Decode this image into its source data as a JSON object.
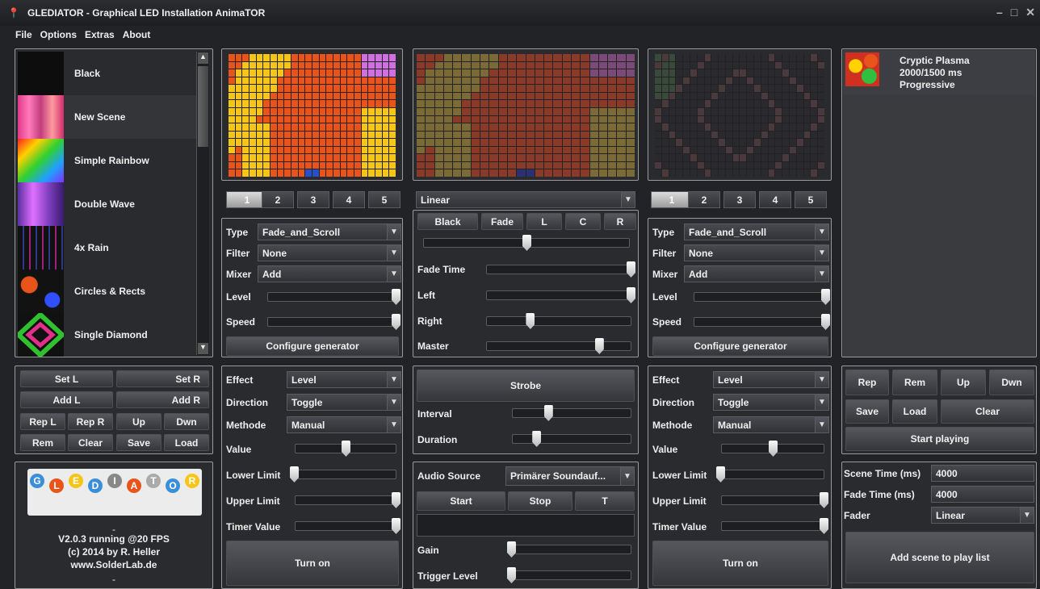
{
  "window": {
    "title": "GLEDIATOR - Graphical LED Installation AnimaTOR",
    "min": "–",
    "max": "□",
    "close": "✕"
  },
  "menu": [
    "File",
    "Options",
    "Extras",
    "About"
  ],
  "scenes": [
    {
      "name": "Black"
    },
    {
      "name": "New Scene"
    },
    {
      "name": "Simple Rainbow"
    },
    {
      "name": "Double Wave"
    },
    {
      "name": "4x Rain"
    },
    {
      "name": "Circles & Rects"
    },
    {
      "name": "Single Diamond"
    }
  ],
  "scene_buttons": [
    "Set L",
    "Set R",
    "Add L",
    "Add R",
    "Rep L",
    "Rep R",
    "Up",
    "Dwn",
    "Rem",
    "Clear",
    "Save",
    "Load"
  ],
  "about": {
    "logo_letters": [
      "G",
      "L",
      "E",
      "D",
      "I",
      "A",
      "T",
      "O",
      "R"
    ],
    "dash1": "-",
    "version": "V2.0.3 running @20 FPS",
    "copyright": "(c) 2014 by R. Heller",
    "url": "www.SolderLab.de",
    "dash2": "-"
  },
  "left_gen": {
    "tabs": [
      "1",
      "2",
      "3",
      "4",
      "5"
    ],
    "type_label": "Type",
    "type_value": "Fade_and_Scroll",
    "filter_label": "Filter",
    "filter_value": "None",
    "mixer_label": "Mixer",
    "mixer_value": "Add",
    "level_label": "Level",
    "level_pct": 100,
    "speed_label": "Speed",
    "speed_pct": 100,
    "configure": "Configure generator",
    "effect_label": "Effect",
    "effect_value": "Level",
    "direction_label": "Direction",
    "direction_value": "Toggle",
    "methode_label": "Methode",
    "methode_value": "Manual",
    "value_label": "Value",
    "value_pct": 50,
    "lower_label": "Lower Limit",
    "lower_pct": 0,
    "upper_label": "Upper Limit",
    "upper_pct": 100,
    "timer_label": "Timer Value",
    "timer_pct": 100,
    "turn_on": "Turn on"
  },
  "right_gen": {
    "tabs": [
      "1",
      "2",
      "3",
      "4",
      "5"
    ],
    "type_label": "Type",
    "type_value": "Fade_and_Scroll",
    "filter_label": "Filter",
    "filter_value": "None",
    "mixer_label": "Mixer",
    "mixer_value": "Add",
    "level_label": "Level",
    "level_pct": 100,
    "speed_label": "Speed",
    "speed_pct": 100,
    "configure": "Configure generator",
    "effect_label": "Effect",
    "effect_value": "Level",
    "direction_label": "Direction",
    "direction_value": "Toggle",
    "methode_label": "Methode",
    "methode_value": "Manual",
    "value_label": "Value",
    "value_pct": 50,
    "lower_label": "Lower Limit",
    "lower_pct": 0,
    "upper_label": "Upper Limit",
    "upper_pct": 100,
    "timer_label": "Timer Value",
    "timer_pct": 100,
    "turn_on": "Turn on"
  },
  "mixer": {
    "fader_type": "Linear",
    "buttons": [
      "Black",
      "Fade",
      "L",
      "C",
      "R"
    ],
    "crossfade_pct": 50,
    "fade_time_label": "Fade Time",
    "fade_time_pct": 100,
    "left_label": "Left",
    "left_pct": 100,
    "right_label": "Right",
    "right_pct": 30,
    "master_label": "Master",
    "master_pct": 78,
    "strobe": "Strobe",
    "interval_label": "Interval",
    "interval_pct": 30,
    "duration_label": "Duration",
    "duration_pct": 20,
    "audio_label": "Audio Source",
    "audio_value": "Primärer Soundauf...",
    "start": "Start",
    "stop": "Stop",
    "t": "T",
    "gain_label": "Gain",
    "gain_pct": 0,
    "trigger_label": "Trigger Level",
    "trigger_pct": 0
  },
  "playlist": {
    "item": {
      "name": "Cryptic Plasma",
      "timing": "2000/1500 ms",
      "mode": "Progressive"
    },
    "buttons": [
      "Rep",
      "Rem",
      "Up",
      "Dwn",
      "Save",
      "Load",
      "Clear"
    ],
    "start_playing": "Start playing",
    "scene_time_label": "Scene Time (ms)",
    "scene_time": "4000",
    "fade_time_label": "Fade Time (ms)",
    "fade_time": "4000",
    "fader_label": "Fader",
    "fader_value": "Linear",
    "add_scene": "Add scene to play list"
  },
  "colors": {
    "accent": "#e8541a",
    "yellow": "#f5c518",
    "panel": "#2a2b2f"
  }
}
